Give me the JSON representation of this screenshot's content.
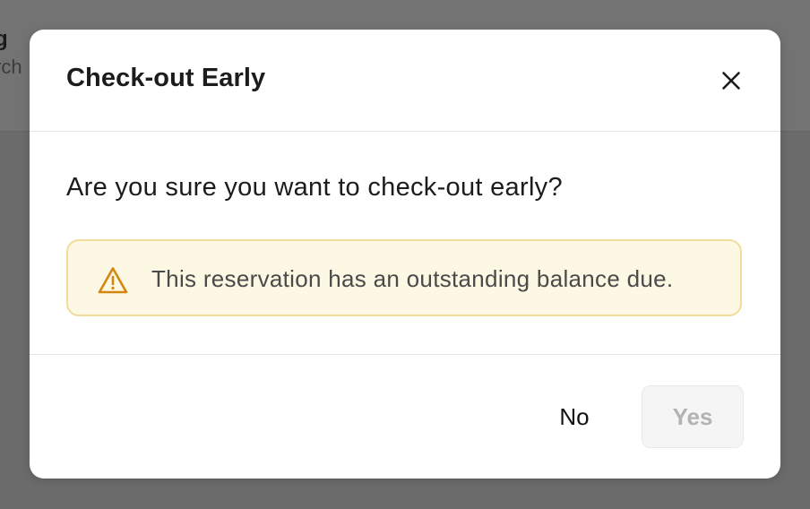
{
  "background": {
    "partial_text_1": "g",
    "partial_text_2": "rch"
  },
  "dialog": {
    "title": "Check-out Early",
    "close_icon": "close-icon",
    "question": "Are you sure you want to check-out early?",
    "warning": {
      "icon": "warning-triangle-icon",
      "text": "This reservation has an outstanding balance due.",
      "background_color": "#fdf8e3",
      "border_color": "#f2dc9c",
      "icon_color": "#d4860f"
    },
    "buttons": {
      "no_label": "No",
      "yes_label": "Yes",
      "yes_disabled": true
    }
  }
}
